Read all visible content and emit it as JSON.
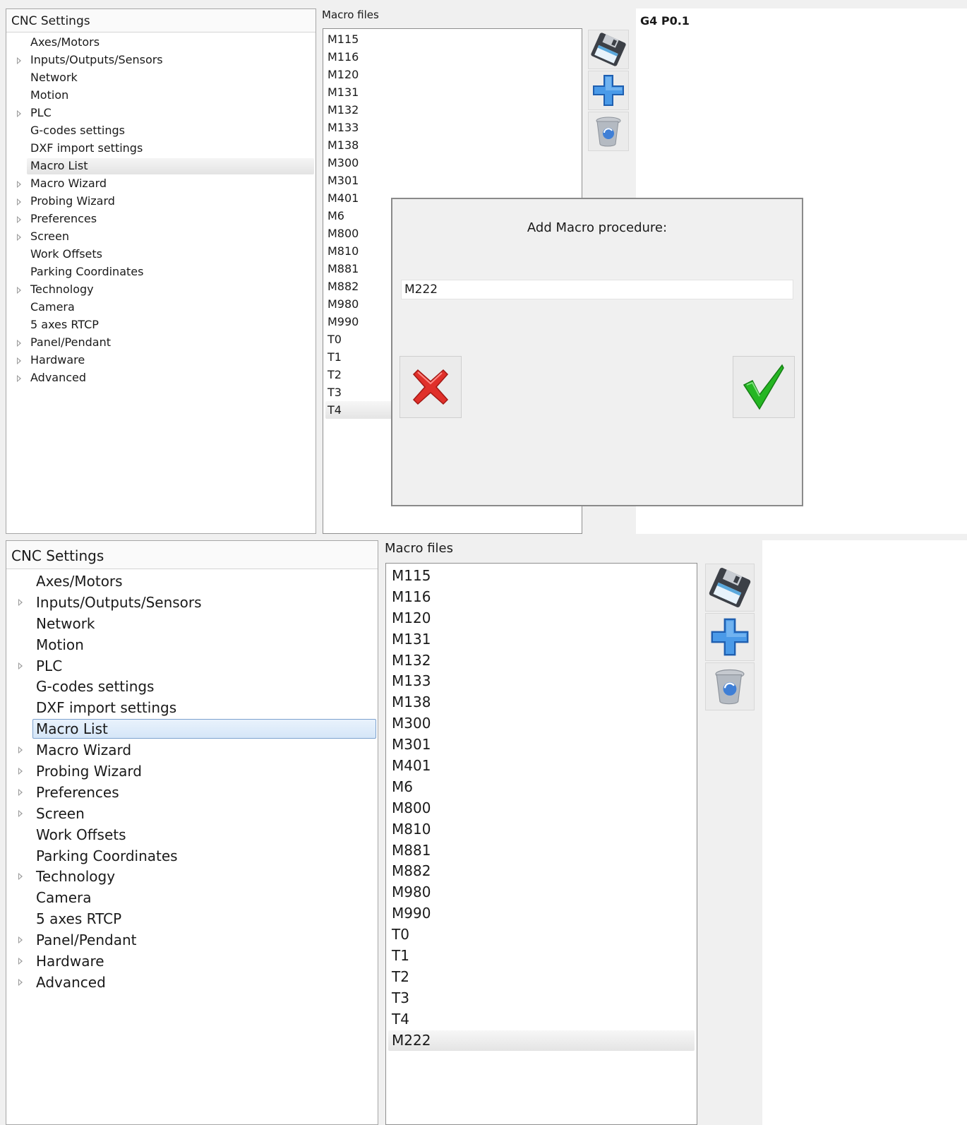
{
  "top": {
    "tree": {
      "header": "CNC Settings",
      "items": [
        {
          "label": "Axes/Motors",
          "expandable": false
        },
        {
          "label": "Inputs/Outputs/Sensors",
          "expandable": true
        },
        {
          "label": "Network",
          "expandable": false
        },
        {
          "label": "Motion",
          "expandable": false
        },
        {
          "label": "PLC",
          "expandable": true
        },
        {
          "label": "G-codes settings",
          "expandable": false
        },
        {
          "label": "DXF import settings",
          "expandable": false
        },
        {
          "label": "Macro List",
          "expandable": false
        },
        {
          "label": "Macro Wizard",
          "expandable": true
        },
        {
          "label": "Probing Wizard",
          "expandable": true
        },
        {
          "label": "Preferences",
          "expandable": true
        },
        {
          "label": "Screen",
          "expandable": true
        },
        {
          "label": "Work Offsets",
          "expandable": false
        },
        {
          "label": "Parking Coordinates",
          "expandable": false
        },
        {
          "label": "Technology",
          "expandable": true
        },
        {
          "label": "Camera",
          "expandable": false
        },
        {
          "label": "5 axes RTCP",
          "expandable": false
        },
        {
          "label": "Panel/Pendant",
          "expandable": true
        },
        {
          "label": "Hardware",
          "expandable": true
        },
        {
          "label": "Advanced",
          "expandable": true
        }
      ],
      "selected_index": 7
    },
    "macro_files_caption": "Macro files",
    "macro_files": [
      "M115",
      "M116",
      "M120",
      "M131",
      "M132",
      "M133",
      "M138",
      "M300",
      "M301",
      "M401",
      "M6",
      "M800",
      "M810",
      "M881",
      "M882",
      "M980",
      "M990",
      "T0",
      "T1",
      "T2",
      "T3",
      "T4"
    ],
    "selected_file_index": 21,
    "editor_text": "G4 P0.1",
    "icons": {
      "save": "floppy-disk-icon",
      "add": "plus-icon",
      "delete": "recycle-bin-icon"
    }
  },
  "dialog": {
    "title": "Add Macro procedure:",
    "input_value": "M222",
    "cancel_icon": "red-x-icon",
    "ok_icon": "green-check-icon"
  },
  "bottom": {
    "tree": {
      "header": "CNC Settings",
      "items": [
        {
          "label": "Axes/Motors",
          "expandable": false
        },
        {
          "label": "Inputs/Outputs/Sensors",
          "expandable": true
        },
        {
          "label": "Network",
          "expandable": false
        },
        {
          "label": "Motion",
          "expandable": false
        },
        {
          "label": "PLC",
          "expandable": true
        },
        {
          "label": "G-codes settings",
          "expandable": false
        },
        {
          "label": "DXF import settings",
          "expandable": false
        },
        {
          "label": "Macro List",
          "expandable": false
        },
        {
          "label": "Macro Wizard",
          "expandable": true
        },
        {
          "label": "Probing Wizard",
          "expandable": true
        },
        {
          "label": "Preferences",
          "expandable": true
        },
        {
          "label": "Screen",
          "expandable": true
        },
        {
          "label": "Work Offsets",
          "expandable": false
        },
        {
          "label": "Parking Coordinates",
          "expandable": false
        },
        {
          "label": "Technology",
          "expandable": true
        },
        {
          "label": "Camera",
          "expandable": false
        },
        {
          "label": "5 axes RTCP",
          "expandable": false
        },
        {
          "label": "Panel/Pendant",
          "expandable": true
        },
        {
          "label": "Hardware",
          "expandable": true
        },
        {
          "label": "Advanced",
          "expandable": true
        }
      ],
      "selected_index": 7
    },
    "macro_files_caption": "Macro files",
    "macro_files": [
      "M115",
      "M116",
      "M120",
      "M131",
      "M132",
      "M133",
      "M138",
      "M300",
      "M301",
      "M401",
      "M6",
      "M800",
      "M810",
      "M881",
      "M882",
      "M980",
      "M990",
      "T0",
      "T1",
      "T2",
      "T3",
      "T4",
      "M222"
    ],
    "selected_file_index": 22,
    "icons": {
      "save": "floppy-disk-icon",
      "add": "plus-icon",
      "delete": "recycle-bin-icon"
    }
  }
}
